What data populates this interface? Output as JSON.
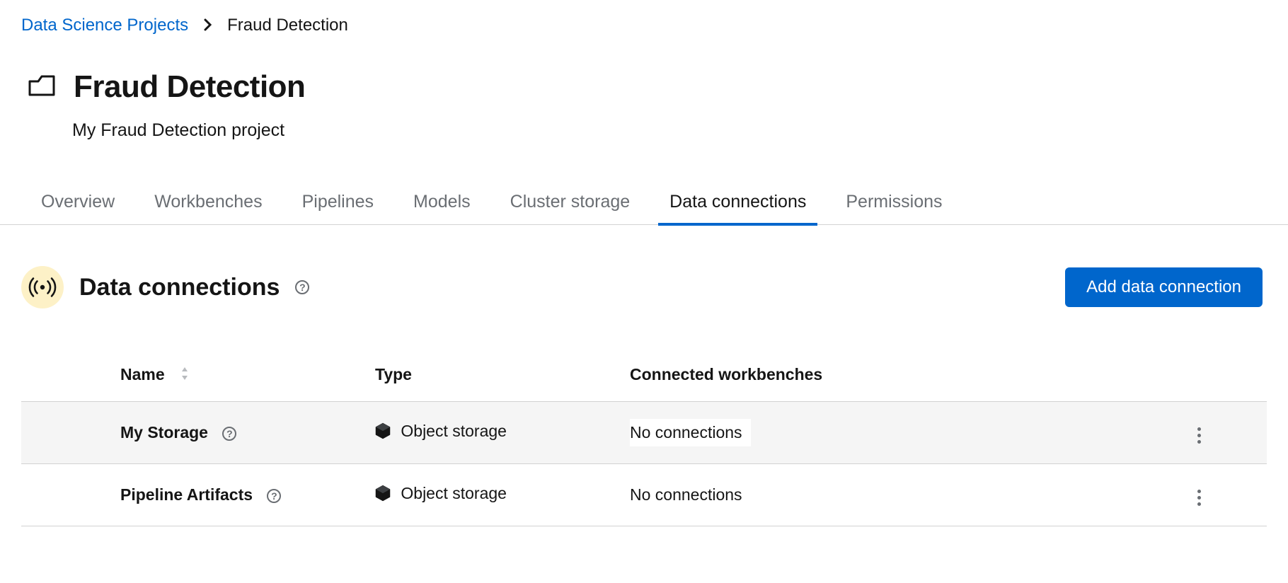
{
  "breadcrumb": {
    "root": "Data Science Projects",
    "current": "Fraud Detection"
  },
  "project": {
    "title": "Fraud Detection",
    "description": "My Fraud Detection project"
  },
  "tabs": [
    {
      "label": "Overview",
      "active": false
    },
    {
      "label": "Workbenches",
      "active": false
    },
    {
      "label": "Pipelines",
      "active": false
    },
    {
      "label": "Models",
      "active": false
    },
    {
      "label": "Cluster storage",
      "active": false
    },
    {
      "label": "Data connections",
      "active": true
    },
    {
      "label": "Permissions",
      "active": false
    }
  ],
  "section": {
    "title": "Data connections",
    "add_button": "Add data connection"
  },
  "table": {
    "columns": {
      "name": "Name",
      "type": "Type",
      "connected": "Connected workbenches"
    },
    "rows": [
      {
        "name": "My Storage",
        "type": "Object storage",
        "connected": "No connections",
        "hover": true
      },
      {
        "name": "Pipeline Artifacts",
        "type": "Object storage",
        "connected": "No connections",
        "hover": false
      }
    ]
  }
}
